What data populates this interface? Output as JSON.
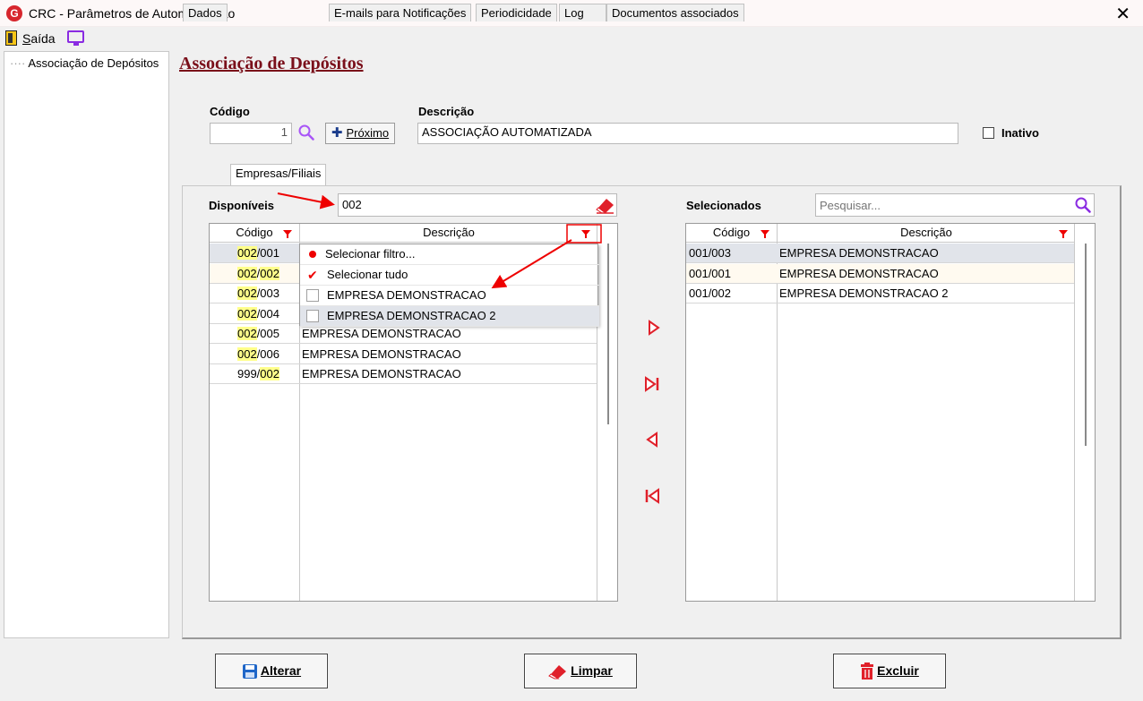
{
  "window": {
    "title": "CRC - Parâmetros de Automatização",
    "close_glyph": "✕",
    "app_icon_letter": "G"
  },
  "menubar": {
    "exit_label": "Saída"
  },
  "tree": {
    "items": [
      {
        "label": "Associação de Depósitos"
      }
    ]
  },
  "header": {
    "section_title": "Associação de Depósitos"
  },
  "form": {
    "codigo_label": "Código",
    "codigo_value": "1",
    "proximo_label": "Próximo",
    "descricao_label": "Descrição",
    "descricao_value": "ASSOCIAÇÃO AUTOMATIZADA",
    "inativo_label": "Inativo",
    "inativo_checked": false
  },
  "tabs": [
    {
      "label": "Dados",
      "active": false
    },
    {
      "label": "Empresas/Filiais",
      "active": true
    },
    {
      "label": "E-mails para Notificações",
      "active": false
    },
    {
      "label": "Periodicidade",
      "active": false
    },
    {
      "label": "Log",
      "active": false
    },
    {
      "label": "Documentos associados",
      "active": false
    }
  ],
  "disponiveis": {
    "label": "Disponíveis",
    "filter_value": "002",
    "columns": [
      "Código",
      "Descrição"
    ],
    "rows": [
      {
        "codigo": "002/001",
        "descricao": ""
      },
      {
        "codigo": "002/002",
        "descricao": ""
      },
      {
        "codigo": "002/003",
        "descricao": ""
      },
      {
        "codigo": "002/004",
        "descricao": ""
      },
      {
        "codigo": "002/005",
        "descricao": "EMPRESA DEMONSTRACAO"
      },
      {
        "codigo": "002/006",
        "descricao": "EMPRESA DEMONSTRACAO"
      },
      {
        "codigo": "999/002",
        "descricao": "EMPRESA DEMONSTRACAO"
      }
    ]
  },
  "filter_popup": {
    "items": [
      {
        "label": "Selecionar filtro...",
        "kind": "action"
      },
      {
        "label": "Selecionar tudo",
        "kind": "check"
      },
      {
        "label": "EMPRESA DEMONSTRACAO",
        "kind": "checkbox"
      },
      {
        "label": "EMPRESA DEMONSTRACAO 2",
        "kind": "checkbox"
      }
    ]
  },
  "selecionados": {
    "label": "Selecionados",
    "search_placeholder": "Pesquisar...",
    "columns": [
      "Código",
      "Descrição"
    ],
    "rows": [
      {
        "codigo": "001/003",
        "descricao": "EMPRESA DEMONSTRACAO"
      },
      {
        "codigo": "001/001",
        "descricao": "EMPRESA DEMONSTRACAO"
      },
      {
        "codigo": "001/002",
        "descricao": "EMPRESA DEMONSTRACAO 2"
      }
    ]
  },
  "footer": {
    "alterar_label": "Alterar",
    "limpar_label": "Limpar",
    "excluir_label": "Excluir"
  },
  "colors": {
    "title_red": "#7a0f1a",
    "accent_red": "#e00000",
    "search_purple": "#8a2be2",
    "highlight_yellow": "#ffff8a"
  }
}
